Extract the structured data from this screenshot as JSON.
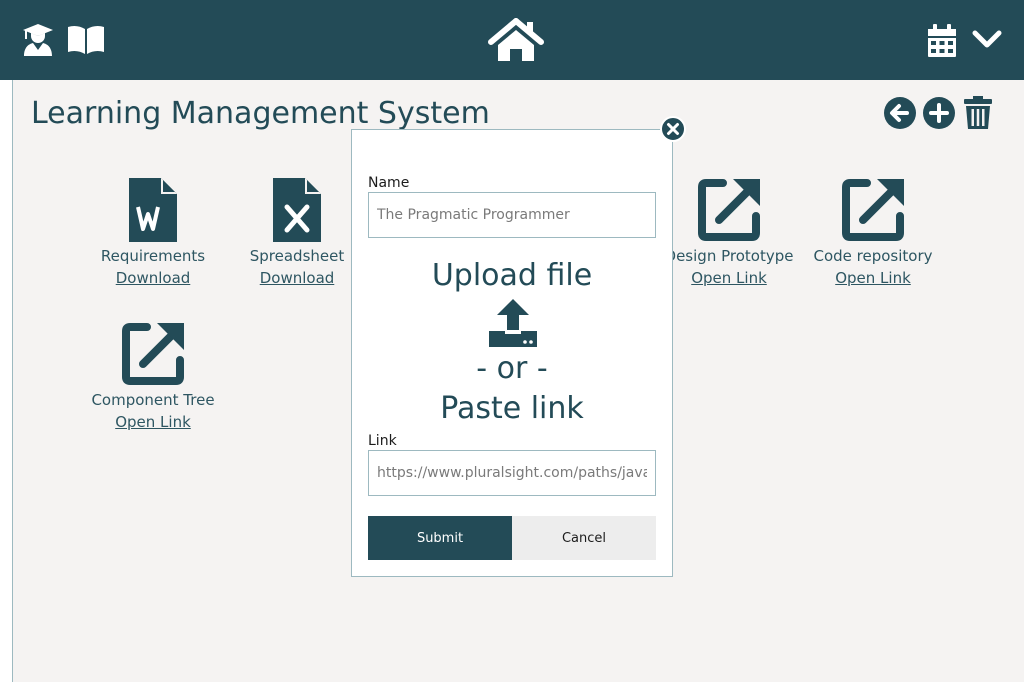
{
  "header": {
    "icons": [
      "graduate-icon",
      "book-icon",
      "home-icon",
      "calendar-icon",
      "chevron-down-icon"
    ]
  },
  "page": {
    "title": "Learning Management System",
    "actions": [
      "back-icon",
      "add-icon",
      "trash-icon"
    ]
  },
  "files": [
    {
      "name": "Requirements",
      "link": "Download",
      "icon": "word-file-icon"
    },
    {
      "name": "Spreadsheet",
      "link": "Download",
      "icon": "excel-file-icon"
    },
    {
      "name": "Design Prototype",
      "link": "Open Link",
      "icon": "external-link-icon"
    },
    {
      "name": "Code repository",
      "link": "Open Link",
      "icon": "external-link-icon"
    },
    {
      "name": "Component Tree",
      "link": "Open Link",
      "icon": "external-link-icon"
    }
  ],
  "modal": {
    "name_label": "Name",
    "name_value": "The Pragmatic Programmer",
    "upload_title": "Upload file",
    "or_text": "- or -",
    "paste_title": "Paste link",
    "link_label": "Link",
    "link_value": "https://www.pluralsight.com/paths/javascript",
    "submit_label": "Submit",
    "cancel_label": "Cancel"
  },
  "colors": {
    "primary": "#234b57",
    "background": "#f5f3f2",
    "border": "#9db9c0",
    "cancel_bg": "#ededed"
  }
}
